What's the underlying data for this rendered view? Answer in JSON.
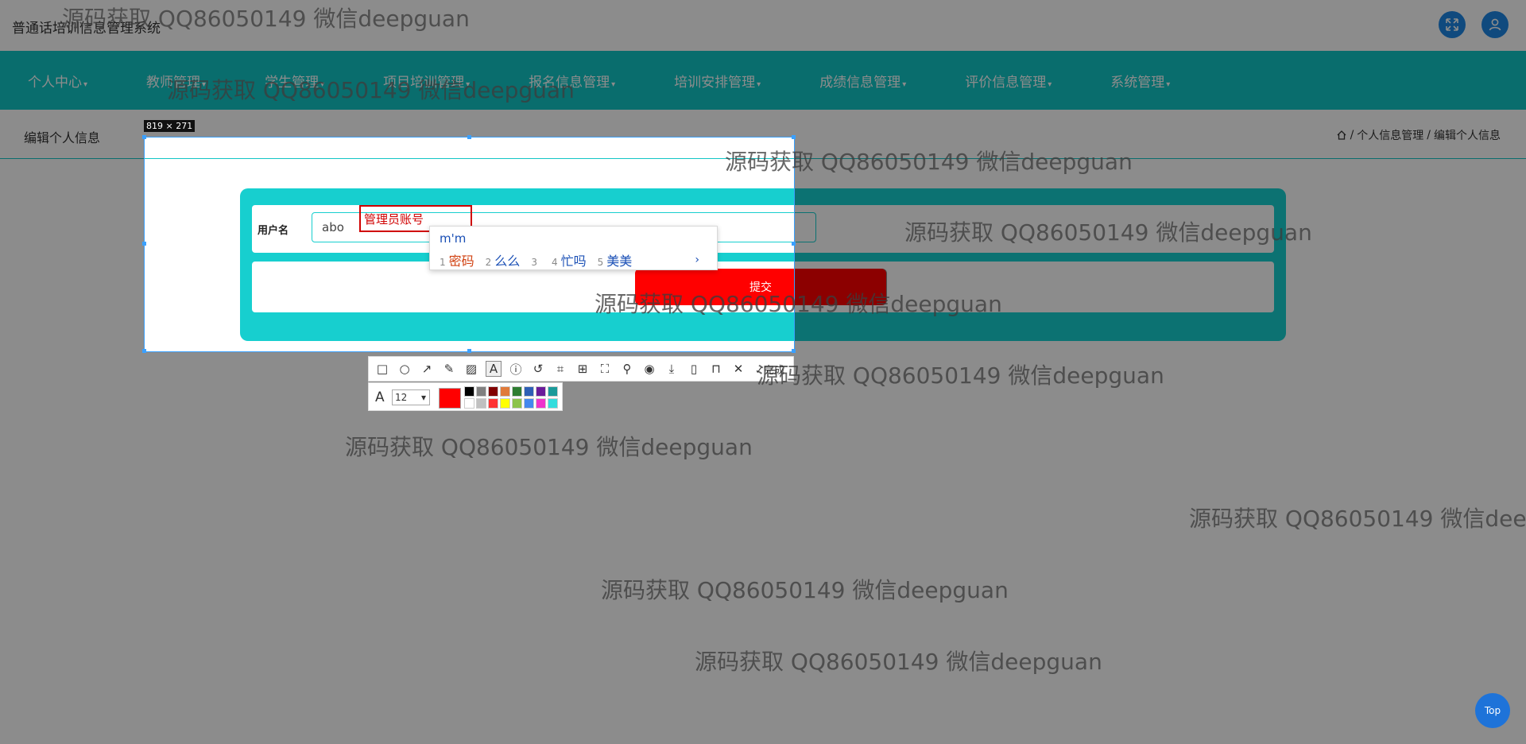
{
  "app": {
    "title": "普通话培训信息管理系统"
  },
  "header_icons": [
    {
      "name": "fullscreen-icon"
    },
    {
      "name": "user-avatar-icon"
    }
  ],
  "nav": {
    "items": [
      {
        "label": "个人中心"
      },
      {
        "label": "教师管理"
      },
      {
        "label": "学生管理"
      },
      {
        "label": "项目培训管理"
      },
      {
        "label": "报名信息管理"
      },
      {
        "label": "培训安排管理"
      },
      {
        "label": "成绩信息管理"
      },
      {
        "label": "评价信息管理"
      },
      {
        "label": "系统管理"
      }
    ]
  },
  "page": {
    "title": "编辑个人信息",
    "breadcrumb": [
      "个人信息管理",
      "编辑个人信息"
    ],
    "separator": "/"
  },
  "form": {
    "username_label": "用户名",
    "username_value": "abo",
    "submit_label": "提交"
  },
  "screenshot_tool": {
    "selection_size": "819 × 271",
    "annotation_text": "管理员账号",
    "font_size": "12",
    "done_label": "完成",
    "current_color": "#ff0000",
    "palette": [
      "#000000",
      "#808080",
      "#800000",
      "#e07a3a",
      "#2e7d32",
      "#2e5fb5",
      "#6a1b9a",
      "#1a9a9a",
      "#ffffff",
      "#c0c0c0",
      "#ff3333",
      "#ffff00",
      "#8bc34a",
      "#4488ee",
      "#ee33cc",
      "#33dddd"
    ]
  },
  "ime": {
    "composition": "m'm",
    "candidates": [
      {
        "num": "1",
        "text": "密码"
      },
      {
        "num": "2",
        "text": "么么"
      },
      {
        "num": "3",
        "text": ""
      },
      {
        "num": "4",
        "text": "忙吗"
      },
      {
        "num": "5",
        "text": "美美"
      }
    ],
    "next": "›"
  },
  "watermark_text": "源码获取 QQ86050149 微信deepguan",
  "back_to_top": "Top",
  "colors": {
    "accent": "#12c6c6",
    "form_bg": "#17cfcf",
    "submit": "#ff0000",
    "icon_blue": "#1e88e5"
  }
}
